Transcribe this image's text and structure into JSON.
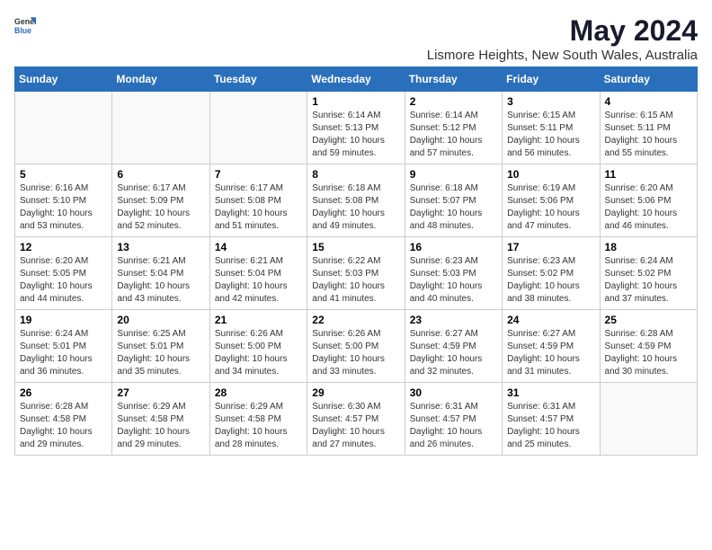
{
  "logo": {
    "text_general": "General",
    "text_blue": "Blue"
  },
  "title": "May 2024",
  "subtitle": "Lismore Heights, New South Wales, Australia",
  "days_of_week": [
    "Sunday",
    "Monday",
    "Tuesday",
    "Wednesday",
    "Thursday",
    "Friday",
    "Saturday"
  ],
  "weeks": [
    [
      {
        "day": "",
        "sunrise": "",
        "sunset": "",
        "daylight": "",
        "empty": true
      },
      {
        "day": "",
        "sunrise": "",
        "sunset": "",
        "daylight": "",
        "empty": true
      },
      {
        "day": "",
        "sunrise": "",
        "sunset": "",
        "daylight": "",
        "empty": true
      },
      {
        "day": "1",
        "sunrise": "Sunrise: 6:14 AM",
        "sunset": "Sunset: 5:13 PM",
        "daylight": "Daylight: 10 hours and 59 minutes."
      },
      {
        "day": "2",
        "sunrise": "Sunrise: 6:14 AM",
        "sunset": "Sunset: 5:12 PM",
        "daylight": "Daylight: 10 hours and 57 minutes."
      },
      {
        "day": "3",
        "sunrise": "Sunrise: 6:15 AM",
        "sunset": "Sunset: 5:11 PM",
        "daylight": "Daylight: 10 hours and 56 minutes."
      },
      {
        "day": "4",
        "sunrise": "Sunrise: 6:15 AM",
        "sunset": "Sunset: 5:11 PM",
        "daylight": "Daylight: 10 hours and 55 minutes."
      }
    ],
    [
      {
        "day": "5",
        "sunrise": "Sunrise: 6:16 AM",
        "sunset": "Sunset: 5:10 PM",
        "daylight": "Daylight: 10 hours and 53 minutes."
      },
      {
        "day": "6",
        "sunrise": "Sunrise: 6:17 AM",
        "sunset": "Sunset: 5:09 PM",
        "daylight": "Daylight: 10 hours and 52 minutes."
      },
      {
        "day": "7",
        "sunrise": "Sunrise: 6:17 AM",
        "sunset": "Sunset: 5:08 PM",
        "daylight": "Daylight: 10 hours and 51 minutes."
      },
      {
        "day": "8",
        "sunrise": "Sunrise: 6:18 AM",
        "sunset": "Sunset: 5:08 PM",
        "daylight": "Daylight: 10 hours and 49 minutes."
      },
      {
        "day": "9",
        "sunrise": "Sunrise: 6:18 AM",
        "sunset": "Sunset: 5:07 PM",
        "daylight": "Daylight: 10 hours and 48 minutes."
      },
      {
        "day": "10",
        "sunrise": "Sunrise: 6:19 AM",
        "sunset": "Sunset: 5:06 PM",
        "daylight": "Daylight: 10 hours and 47 minutes."
      },
      {
        "day": "11",
        "sunrise": "Sunrise: 6:20 AM",
        "sunset": "Sunset: 5:06 PM",
        "daylight": "Daylight: 10 hours and 46 minutes."
      }
    ],
    [
      {
        "day": "12",
        "sunrise": "Sunrise: 6:20 AM",
        "sunset": "Sunset: 5:05 PM",
        "daylight": "Daylight: 10 hours and 44 minutes."
      },
      {
        "day": "13",
        "sunrise": "Sunrise: 6:21 AM",
        "sunset": "Sunset: 5:04 PM",
        "daylight": "Daylight: 10 hours and 43 minutes."
      },
      {
        "day": "14",
        "sunrise": "Sunrise: 6:21 AM",
        "sunset": "Sunset: 5:04 PM",
        "daylight": "Daylight: 10 hours and 42 minutes."
      },
      {
        "day": "15",
        "sunrise": "Sunrise: 6:22 AM",
        "sunset": "Sunset: 5:03 PM",
        "daylight": "Daylight: 10 hours and 41 minutes."
      },
      {
        "day": "16",
        "sunrise": "Sunrise: 6:23 AM",
        "sunset": "Sunset: 5:03 PM",
        "daylight": "Daylight: 10 hours and 40 minutes."
      },
      {
        "day": "17",
        "sunrise": "Sunrise: 6:23 AM",
        "sunset": "Sunset: 5:02 PM",
        "daylight": "Daylight: 10 hours and 38 minutes."
      },
      {
        "day": "18",
        "sunrise": "Sunrise: 6:24 AM",
        "sunset": "Sunset: 5:02 PM",
        "daylight": "Daylight: 10 hours and 37 minutes."
      }
    ],
    [
      {
        "day": "19",
        "sunrise": "Sunrise: 6:24 AM",
        "sunset": "Sunset: 5:01 PM",
        "daylight": "Daylight: 10 hours and 36 minutes."
      },
      {
        "day": "20",
        "sunrise": "Sunrise: 6:25 AM",
        "sunset": "Sunset: 5:01 PM",
        "daylight": "Daylight: 10 hours and 35 minutes."
      },
      {
        "day": "21",
        "sunrise": "Sunrise: 6:26 AM",
        "sunset": "Sunset: 5:00 PM",
        "daylight": "Daylight: 10 hours and 34 minutes."
      },
      {
        "day": "22",
        "sunrise": "Sunrise: 6:26 AM",
        "sunset": "Sunset: 5:00 PM",
        "daylight": "Daylight: 10 hours and 33 minutes."
      },
      {
        "day": "23",
        "sunrise": "Sunrise: 6:27 AM",
        "sunset": "Sunset: 4:59 PM",
        "daylight": "Daylight: 10 hours and 32 minutes."
      },
      {
        "day": "24",
        "sunrise": "Sunrise: 6:27 AM",
        "sunset": "Sunset: 4:59 PM",
        "daylight": "Daylight: 10 hours and 31 minutes."
      },
      {
        "day": "25",
        "sunrise": "Sunrise: 6:28 AM",
        "sunset": "Sunset: 4:59 PM",
        "daylight": "Daylight: 10 hours and 30 minutes."
      }
    ],
    [
      {
        "day": "26",
        "sunrise": "Sunrise: 6:28 AM",
        "sunset": "Sunset: 4:58 PM",
        "daylight": "Daylight: 10 hours and 29 minutes."
      },
      {
        "day": "27",
        "sunrise": "Sunrise: 6:29 AM",
        "sunset": "Sunset: 4:58 PM",
        "daylight": "Daylight: 10 hours and 29 minutes."
      },
      {
        "day": "28",
        "sunrise": "Sunrise: 6:29 AM",
        "sunset": "Sunset: 4:58 PM",
        "daylight": "Daylight: 10 hours and 28 minutes."
      },
      {
        "day": "29",
        "sunrise": "Sunrise: 6:30 AM",
        "sunset": "Sunset: 4:57 PM",
        "daylight": "Daylight: 10 hours and 27 minutes."
      },
      {
        "day": "30",
        "sunrise": "Sunrise: 6:31 AM",
        "sunset": "Sunset: 4:57 PM",
        "daylight": "Daylight: 10 hours and 26 minutes."
      },
      {
        "day": "31",
        "sunrise": "Sunrise: 6:31 AM",
        "sunset": "Sunset: 4:57 PM",
        "daylight": "Daylight: 10 hours and 25 minutes."
      },
      {
        "day": "",
        "sunrise": "",
        "sunset": "",
        "daylight": "",
        "empty": true
      }
    ]
  ]
}
